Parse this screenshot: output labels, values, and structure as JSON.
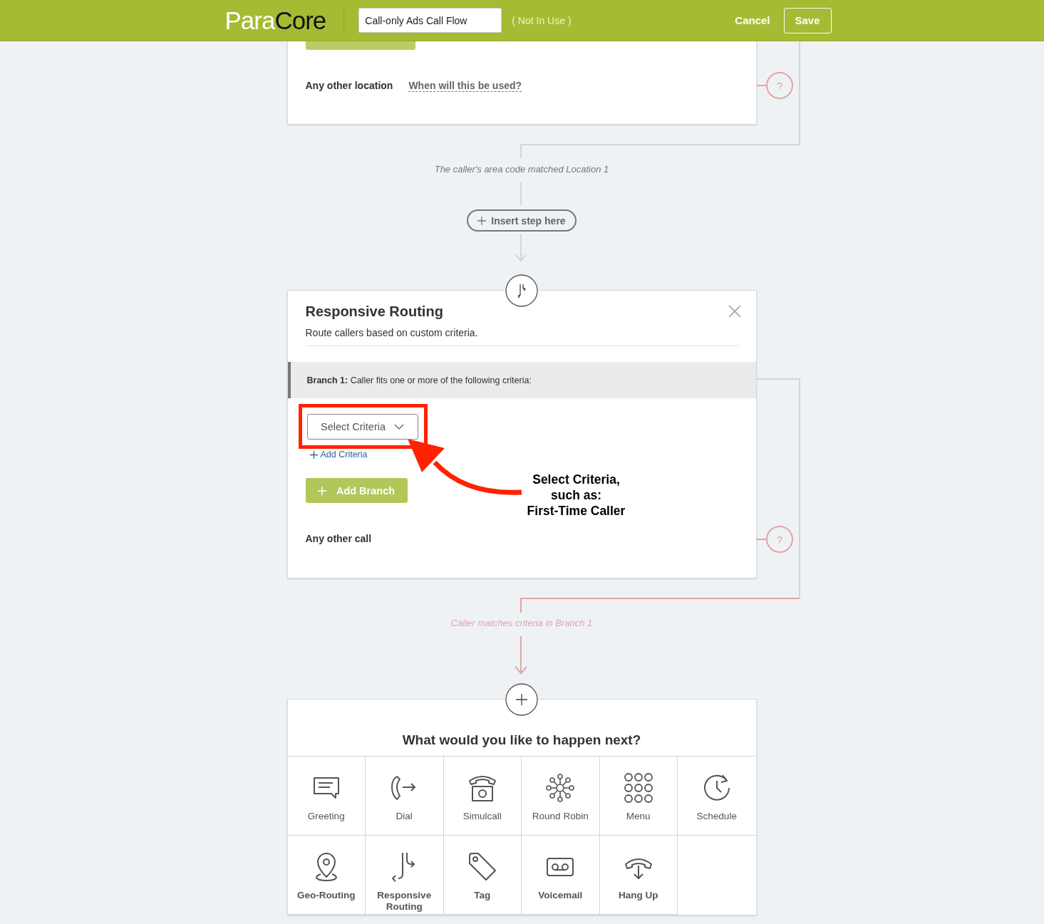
{
  "header": {
    "logo": {
      "first": "Para",
      "second": "Core"
    },
    "flow_name": "Call-only Ads Call Flow",
    "status": "( Not In Use )",
    "cancel": "Cancel",
    "save": "Save"
  },
  "geo_card": {
    "other_label": "Any other location",
    "help_link": "When will this be used?",
    "help_button": "?"
  },
  "branch_label_1": "The caller's area code matched Location 1",
  "insert_step": "Insert step here",
  "routing_card": {
    "title": "Responsive Routing",
    "description": "Route callers based on custom criteria.",
    "branch": "**Branch 1:** Caller fits one or more of the following criteria:",
    "select": "Select Criteria",
    "add_criteria": "Add Criteria",
    "add_branch": "Add Branch",
    "other_label": "Any other call",
    "help_button": "?"
  },
  "annotation": {
    "lines": [
      "Select Criteria,",
      "such as:",
      "First-Time Caller"
    ]
  },
  "branch_label_2": "Caller matches criteria in Branch 1",
  "next_card": {
    "title": "What would you like to happen next?",
    "tiles": [
      {
        "kind": "greeting",
        "label": "Greeting",
        "bold": false
      },
      {
        "kind": "dial",
        "label": "Dial",
        "bold": false
      },
      {
        "kind": "simulcall",
        "label": "Simulcall",
        "bold": false
      },
      {
        "kind": "roundrobin",
        "label": "Round Robin",
        "bold": false
      },
      {
        "kind": "menu",
        "label": "Menu",
        "bold": false
      },
      {
        "kind": "schedule",
        "label": "Schedule",
        "bold": false
      },
      {
        "kind": "geo",
        "label": "Geo-Routing",
        "bold": true
      },
      {
        "kind": "routing",
        "label": "Responsive Routing",
        "bold": true
      },
      {
        "kind": "tag",
        "label": "Tag",
        "bold": true
      },
      {
        "kind": "voicemail",
        "label": "Voicemail",
        "bold": true
      },
      {
        "kind": "hangup",
        "label": "Hang Up",
        "bold": true
      }
    ]
  }
}
